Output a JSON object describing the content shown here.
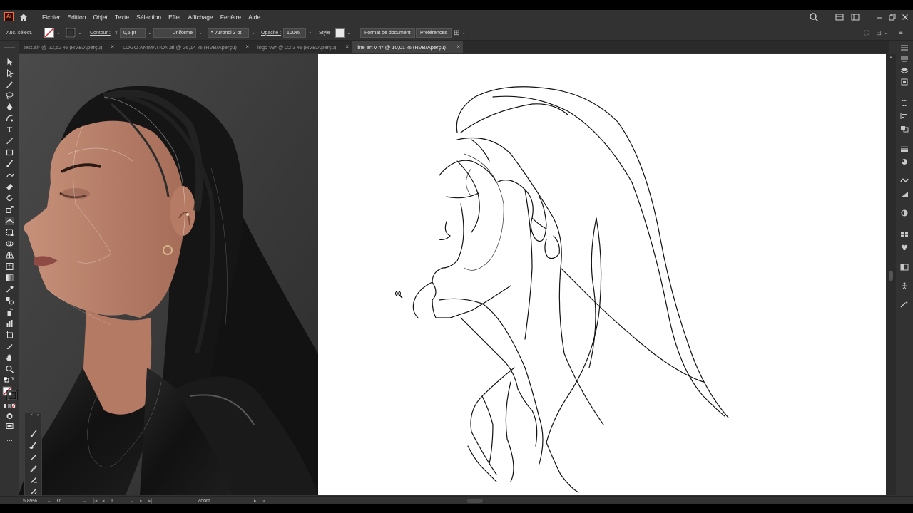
{
  "app": {
    "logo_text": "Ai"
  },
  "menu": {
    "items": [
      "Fichier",
      "Edition",
      "Objet",
      "Texte",
      "Sélection",
      "Effet",
      "Affichage",
      "Fenêtre",
      "Aide"
    ]
  },
  "control_bar": {
    "selection_label": "Auc. sélect.",
    "contour_label": "Contour :",
    "stroke_weight": "0,5 pt",
    "profile": "Uniforme",
    "brush": "Arrondi 3 pt",
    "opacity_label": "Opacité :",
    "opacity_value": "100%",
    "style_label": "Style :",
    "doc_format_button": "Format de document",
    "preferences_button": "Préférences"
  },
  "tabs": [
    {
      "label": "test.ai* @ 22,52 % (RVB/Aperçu)",
      "active": false
    },
    {
      "label": "LOGO ANIMATION.ai @ 26,14 % (RVB/Aperçu)",
      "active": false
    },
    {
      "label": "logo v3* @ 22,3 % (RVB/Aperçu)",
      "active": false
    },
    {
      "label": "line art v 4* @ 10,01 % (RVB/Aperçu)",
      "active": true
    }
  ],
  "tab_close_glyph": "×",
  "status_bar": {
    "zoom": "5,89%",
    "rotation": "0°",
    "artboard_number": "1",
    "tool_name": "Zoom"
  },
  "colors": {
    "accent_orange": "#ff7c3b",
    "panel_bg": "#323232",
    "artboard_bg": "#ffffff",
    "stroke_red": "#e0232e"
  }
}
